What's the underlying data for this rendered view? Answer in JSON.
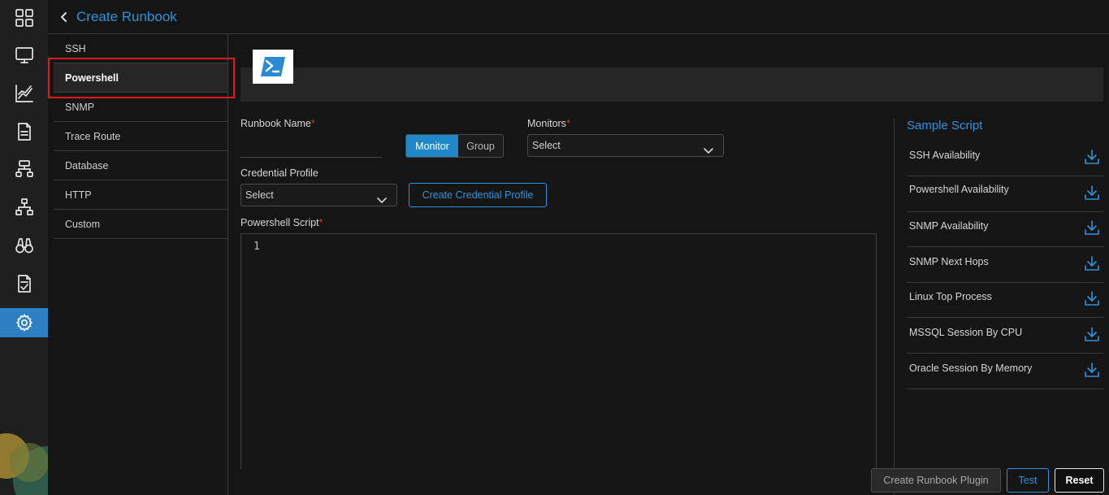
{
  "rail": {
    "items": [
      {
        "icon": "dashboard-grid-icon"
      },
      {
        "icon": "monitor-icon"
      },
      {
        "icon": "metrics-chart-icon"
      },
      {
        "icon": "document-icon"
      },
      {
        "icon": "network-topology-icon"
      },
      {
        "icon": "hierarchy-icon"
      },
      {
        "icon": "binoculars-icon"
      },
      {
        "icon": "checklist-icon"
      },
      {
        "icon": "settings-gear-icon",
        "active": true
      }
    ]
  },
  "header": {
    "back_icon": "chevron-left-icon",
    "title": "Create Runbook"
  },
  "types": {
    "items": [
      "SSH",
      "Powershell",
      "SNMP",
      "Trace Route",
      "Database",
      "HTTP",
      "Custom"
    ],
    "selected": "Powershell"
  },
  "banner": {
    "logo_icon": "powershell-logo-icon"
  },
  "form": {
    "runbook_name_label": "Runbook Name",
    "required_mark": "*",
    "toggle_monitor": "Monitor",
    "toggle_group": "Group",
    "monitors_label": "Monitors",
    "monitors_value": "Select",
    "credential_label": "Credential Profile",
    "credential_value": "Select",
    "create_credential_button": "Create Credential Profile",
    "script_label": "Powershell Script",
    "editor_line_number": "1"
  },
  "sample_script": {
    "title": "Sample Script",
    "items": [
      "SSH Availability",
      "Powershell Availability",
      "SNMP Availability",
      "SNMP Next Hops",
      "Linux Top Process",
      "MSSQL Session By CPU",
      "Oracle Session By Memory"
    ],
    "download_icon": "download-icon"
  },
  "footer": {
    "create_plugin": "Create Runbook Plugin",
    "test": "Test",
    "reset": "Reset"
  },
  "colors": {
    "accent": "#2d93dc",
    "active_rail": "#2b7fc3",
    "required": "#e0313a",
    "highlight": "#e0191e",
    "background": "#151515"
  }
}
